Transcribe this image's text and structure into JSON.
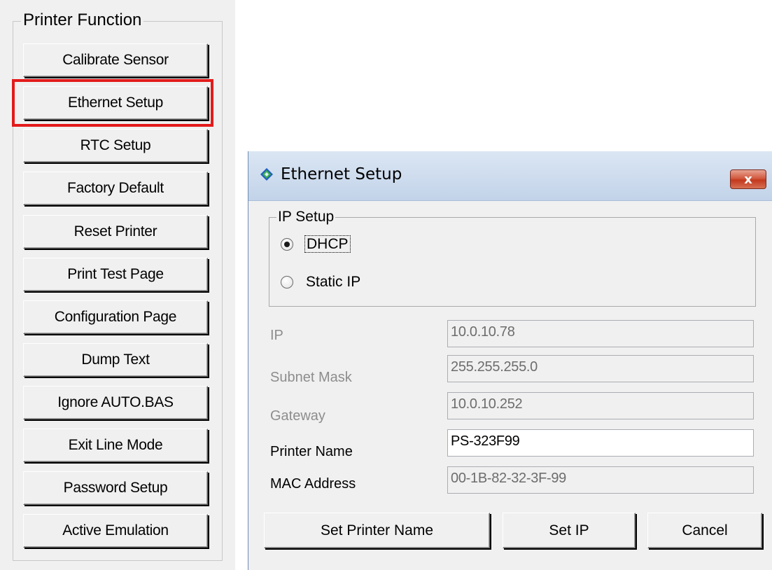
{
  "printer_function": {
    "title": "Printer Function",
    "buttons": [
      "Calibrate Sensor",
      "Ethernet Setup",
      "RTC Setup",
      "Factory Default",
      "Reset Printer",
      "Print Test Page",
      "Configuration Page",
      "Dump Text",
      "Ignore AUTO.BAS",
      "Exit Line Mode",
      "Password Setup",
      "Active Emulation"
    ],
    "highlighted_button": "Ethernet Setup",
    "highlight_color": "#e31b1b"
  },
  "dialog": {
    "title": "Ethernet Setup",
    "title_icon": "diamond-app-icon",
    "close_label": "x",
    "ip_setup": {
      "title": "IP Setup",
      "options": [
        {
          "label": "DHCP",
          "checked": true
        },
        {
          "label": "Static IP",
          "checked": false
        }
      ]
    },
    "fields": {
      "ip": {
        "label": "IP",
        "value": "10.0.10.78",
        "enabled": false
      },
      "subnet": {
        "label": "Subnet Mask",
        "value": "255.255.255.0",
        "enabled": false
      },
      "gateway": {
        "label": "Gateway",
        "value": "10.0.10.252",
        "enabled": false
      },
      "printer_name": {
        "label": "Printer Name",
        "value": "PS-323F99",
        "enabled": true
      },
      "mac": {
        "label": "MAC Address",
        "value": "00-1B-82-32-3F-99",
        "enabled": false
      }
    },
    "buttons": {
      "set_printer_name": "Set Printer Name",
      "set_ip": "Set IP",
      "cancel": "Cancel"
    },
    "close_button_color": "#c3391e"
  }
}
